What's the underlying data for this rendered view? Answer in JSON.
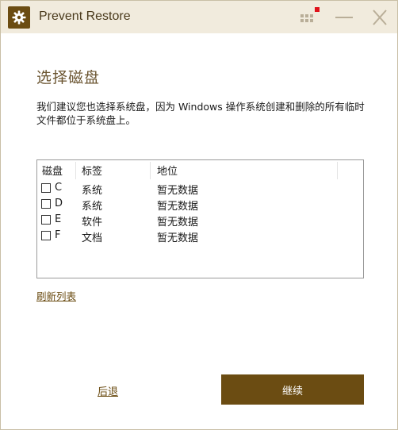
{
  "window": {
    "title": "Prevent Restore",
    "icon": "gear-icon",
    "controls": {
      "menu_icon": "menu-dots-icon",
      "minimize_icon": "minimize-icon",
      "close_icon": "close-icon",
      "notification_color": "#e0131b"
    }
  },
  "page": {
    "heading": "选择磁盘",
    "description": "我们建议您也选择系统盘，因为 Windows 操作系统创建和删除的所有临时文件都位于系统盘上。",
    "columns": [
      "磁盘",
      "标签",
      "地位"
    ],
    "disks": [
      {
        "letter": "C",
        "label": "系统",
        "status": "暂无数据",
        "checked": false
      },
      {
        "letter": "D",
        "label": "系统",
        "status": "暂无数据",
        "checked": false
      },
      {
        "letter": "E",
        "label": "软件",
        "status": "暂无数据",
        "checked": false
      },
      {
        "letter": "F",
        "label": "文档",
        "status": "暂无数据",
        "checked": false
      }
    ],
    "refresh_label": "刷新列表"
  },
  "footer": {
    "back_label": "后退",
    "continue_label": "继续"
  },
  "colors": {
    "accent": "#6b4c12",
    "titlebar_bg": "#f1ebdd",
    "heading": "#6b5531"
  }
}
